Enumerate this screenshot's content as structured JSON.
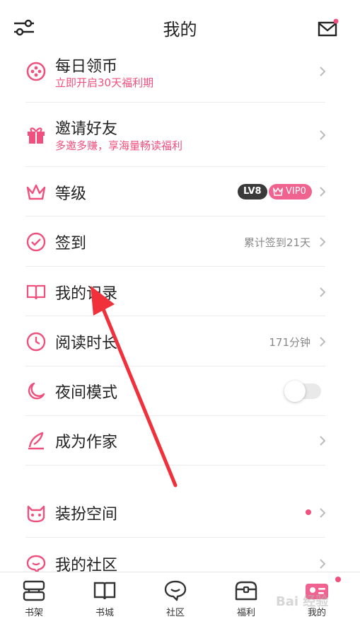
{
  "header": {
    "title": "我的"
  },
  "menu": [
    {
      "label": "每日领币",
      "sub": "立即开启30天福利期"
    },
    {
      "label": "邀请好友",
      "sub": "多邀多赚，享海量畅读福利"
    },
    {
      "label": "等级",
      "badge_lv": "LV8",
      "badge_vip": "VIP0"
    },
    {
      "label": "签到",
      "right": "累计签到21天"
    },
    {
      "label": "我的记录"
    },
    {
      "label": "阅读时长",
      "right": "171分钟"
    },
    {
      "label": "夜间模式",
      "toggle": false
    },
    {
      "label": "成为作家"
    },
    {
      "label": "装扮空间"
    },
    {
      "label": "我的社区"
    }
  ],
  "tabs": [
    {
      "label": "书架"
    },
    {
      "label": "书城"
    },
    {
      "label": "社区"
    },
    {
      "label": "福利"
    },
    {
      "label": "我的"
    }
  ],
  "watermark": "Bai 经验",
  "colors": {
    "accent": "#f0507d",
    "vip": "#f06391",
    "lv": "#3a3a3a",
    "arrow": "#f0303a"
  }
}
